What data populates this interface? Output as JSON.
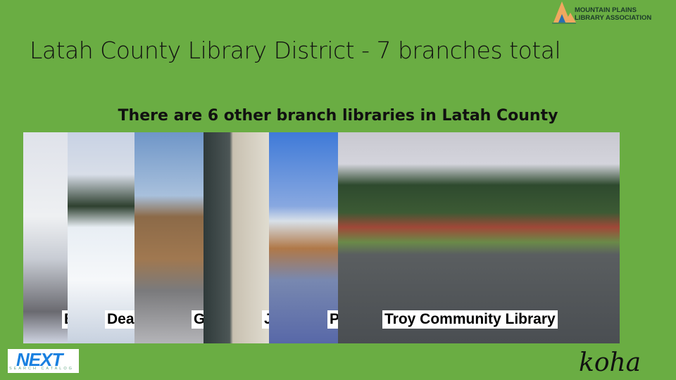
{
  "logos": {
    "top_right": "MOUNTAIN PLAINS LIBRARY ASSOCIATION",
    "top_right_line1": "MOUNTAIN PLAINS",
    "top_right_line2": "LIBRARY ASSOCIATION",
    "bottom_left": "NEXT",
    "bottom_left_sub": "SEARCH CATALOG",
    "bottom_right": "koha"
  },
  "title": "Latah County Library District - 7 branches total",
  "subtitle": "There are 6 other branch libraries in Latah County",
  "photos": [
    {
      "label": "B"
    },
    {
      "label": "Dea"
    },
    {
      "label": "G"
    },
    {
      "label": "J"
    },
    {
      "label": "P"
    },
    {
      "label": "Troy Community Library"
    }
  ]
}
